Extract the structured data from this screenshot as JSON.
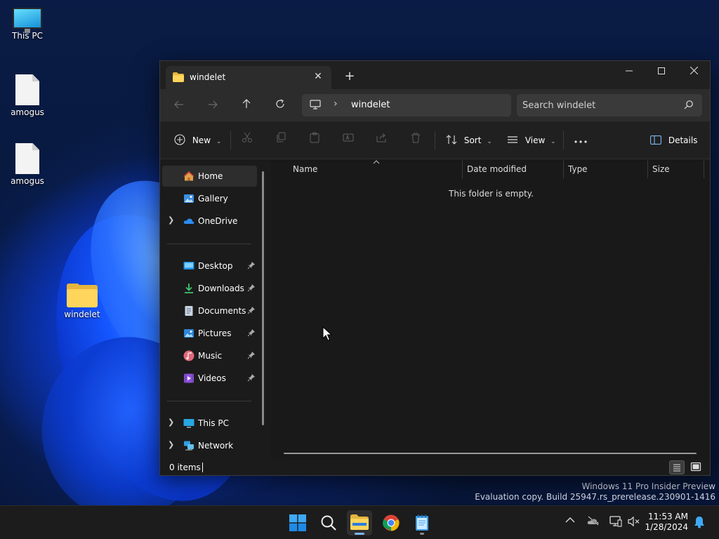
{
  "desktop": {
    "icons": [
      {
        "label": "This PC"
      },
      {
        "label": "amogus"
      },
      {
        "label": "amogus"
      },
      {
        "label": "windelet"
      }
    ],
    "watermark": {
      "line1": "Windows 11 Pro Insider Preview",
      "line2": "Evaluation copy. Build 25947.rs_prerelease.230901-1416"
    }
  },
  "explorer": {
    "tab_title": "windelet",
    "address": {
      "breadcrumb": "windelet"
    },
    "search": {
      "placeholder": "Search windelet"
    },
    "toolbar": {
      "new_label": "New",
      "sort_label": "Sort",
      "view_label": "View",
      "details_label": "Details"
    },
    "sidebar": {
      "items": [
        {
          "label": "Home"
        },
        {
          "label": "Gallery"
        },
        {
          "label": "OneDrive"
        },
        {
          "label": "Desktop"
        },
        {
          "label": "Downloads"
        },
        {
          "label": "Documents"
        },
        {
          "label": "Pictures"
        },
        {
          "label": "Music"
        },
        {
          "label": "Videos"
        },
        {
          "label": "This PC"
        },
        {
          "label": "Network"
        }
      ]
    },
    "columns": {
      "name": "Name",
      "date_modified": "Date modified",
      "type": "Type",
      "size": "Size"
    },
    "empty_message": "This folder is empty.",
    "status": {
      "item_count": "0 items"
    }
  },
  "taskbar": {
    "time": "11:53 AM",
    "date": "1/28/2024"
  },
  "colors": {
    "accent": "#7ab7f5",
    "window_bg": "#1b1b1b",
    "taskbar_bg": "#1c1c1c"
  }
}
